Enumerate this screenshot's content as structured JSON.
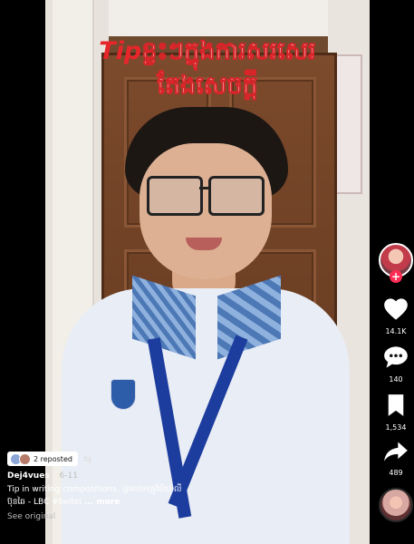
{
  "video": {
    "title_tip": "Tip",
    "title_line1_rest": "ខ្លះៗក្នុងការសរសេរ",
    "title_line2": "តែងសេចក្តី"
  },
  "actions": {
    "likes": "14.1K",
    "comments": "140",
    "saves": "1,534",
    "shares": "489",
    "follow_symbol": "+"
  },
  "caption": {
    "repost_label": "2 reposted",
    "username": "Dej4vues",
    "date": "6-11",
    "line1": "Tip in writing compositions. @លោកគ្រូវិច័យ លី",
    "line2_prefix": "ប៊ុនឆៃ - LBC #beltei",
    "more_label": "... more",
    "see_original": "See original"
  },
  "colors": {
    "accent": "#fe2c55",
    "title_red": "#e7262b"
  },
  "icons": {
    "like": "heart-icon",
    "comment": "comment-icon",
    "save": "bookmark-icon",
    "share": "share-icon",
    "repost": "repost-icon"
  }
}
